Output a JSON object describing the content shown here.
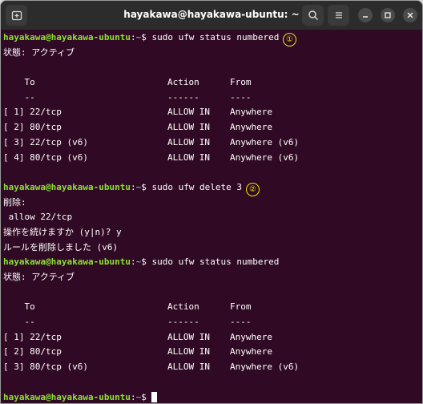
{
  "window": {
    "title": "hayakawa@hayakawa-ubuntu: ~",
    "icons": {
      "new_tab": "new-tab-icon",
      "search": "search-icon",
      "menu": "hamburger-menu-icon",
      "minimize": "minimize-icon",
      "maximize": "maximize-icon",
      "close": "close-icon"
    }
  },
  "prompt": {
    "user": "hayakawa@hayakawa-ubuntu",
    "path": "~",
    "symbol": "$"
  },
  "colors": {
    "background": "#300a24",
    "user": "#8ae234",
    "path": "#729fcf",
    "annotation": "#e8e800"
  },
  "session1": {
    "command": "sudo ufw status numbered",
    "status": "状態: アクティブ",
    "header": {
      "to": "To",
      "action": "Action",
      "from": "From"
    },
    "dashes": {
      "to": "--",
      "action": "------",
      "from": "----"
    },
    "rows": [
      {
        "to": "[ 1] 22/tcp",
        "action": "ALLOW IN",
        "from": "Anywhere"
      },
      {
        "to": "[ 2] 80/tcp",
        "action": "ALLOW IN",
        "from": "Anywhere"
      },
      {
        "to": "[ 3] 22/tcp (v6)",
        "action": "ALLOW IN",
        "from": "Anywhere (v6)"
      },
      {
        "to": "[ 4] 80/tcp (v6)",
        "action": "ALLOW IN",
        "from": "Anywhere (v6)"
      }
    ]
  },
  "session2": {
    "command": "sudo ufw delete 3",
    "output": [
      "削除:",
      " allow 22/tcp",
      "操作を続けますか (y|n)? y",
      "ルールを削除しました (v6)"
    ]
  },
  "session3": {
    "command": "sudo ufw status numbered",
    "status": "状態: アクティブ",
    "header": {
      "to": "To",
      "action": "Action",
      "from": "From"
    },
    "dashes": {
      "to": "--",
      "action": "------",
      "from": "----"
    },
    "rows": [
      {
        "to": "[ 1] 22/tcp",
        "action": "ALLOW IN",
        "from": "Anywhere"
      },
      {
        "to": "[ 2] 80/tcp",
        "action": "ALLOW IN",
        "from": "Anywhere"
      },
      {
        "to": "[ 3] 80/tcp (v6)",
        "action": "ALLOW IN",
        "from": "Anywhere (v6)"
      }
    ]
  },
  "annotations": [
    "①",
    "②"
  ]
}
